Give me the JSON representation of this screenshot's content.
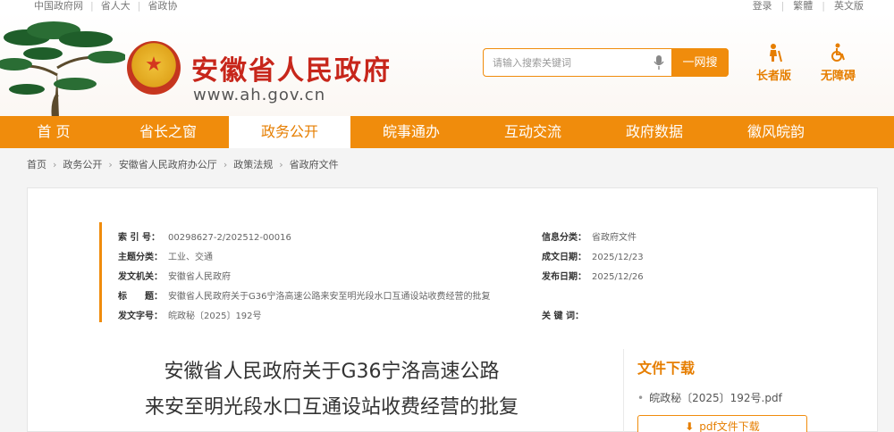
{
  "topbar": {
    "left_links": [
      "中国政府网",
      "省人大",
      "省政协"
    ],
    "right_links": [
      "登录",
      "繁體",
      "英文版"
    ]
  },
  "header": {
    "site_title": "安徽省人民政府",
    "site_url": "www.ah.gov.cn",
    "search_placeholder": "请输入搜索关键词",
    "search_button": "一网搜",
    "elder_mode": "长者版",
    "accessibility": "无障碍"
  },
  "nav": {
    "items": [
      "首 页",
      "省长之窗",
      "政务公开",
      "皖事通办",
      "互动交流",
      "政府数据",
      "徽风皖韵"
    ],
    "active": "政务公开"
  },
  "breadcrumb": [
    "首页",
    "政务公开",
    "安徽省人民政府办公厅",
    "政策法规",
    "省政府文件"
  ],
  "meta": {
    "index_no_label": "索 引 号：",
    "index_no": "00298627-2/202512-00016",
    "category_label": "主题分类：",
    "category": "工业、交通",
    "issuer_label": "发文机关：",
    "issuer": "安徽省人民政府",
    "title_label": "标　　题：",
    "title": "安徽省人民政府关于G36宁洛高速公路来安至明光段水口互通设站收费经营的批复",
    "doc_no_label": "发文字号：",
    "doc_no": "皖政秘〔2025〕192号",
    "source_label": "信息分类：",
    "source": "省政府文件",
    "created_label": "成文日期：",
    "created": "2025/12/23",
    "published_label": "发布日期：",
    "published": "2025/12/26",
    "keywords_label": "关 键 词：",
    "keywords": ""
  },
  "document": {
    "title_line1": "安徽省人民政府关于G36宁洛高速公路",
    "title_line2": "来安至明光段水口互通设站收费经营的批复"
  },
  "download": {
    "heading": "文件下载",
    "file_name": "皖政秘〔2025〕192号.pdf",
    "button_label": "pdf文件下载"
  },
  "colors": {
    "accent": "#f08c0c",
    "title_red": "#c7261b"
  }
}
